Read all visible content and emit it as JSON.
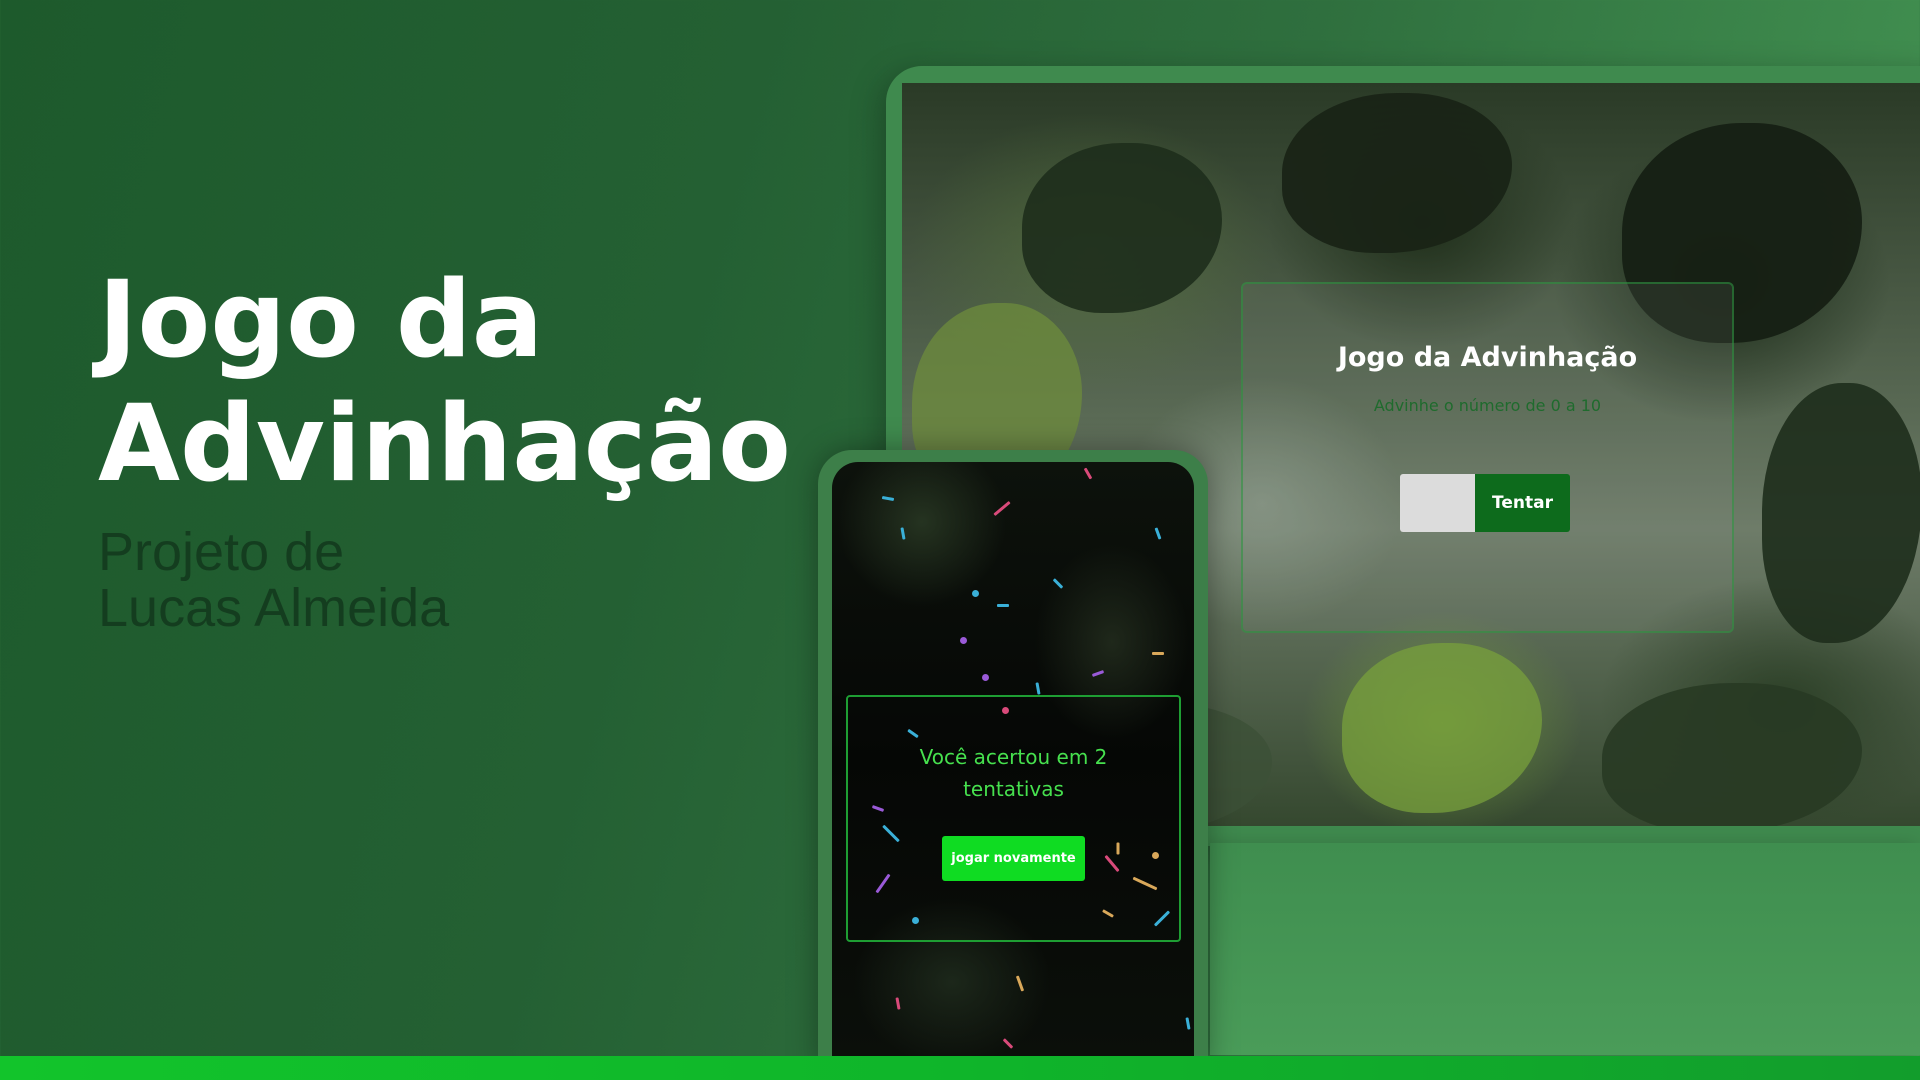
{
  "hero": {
    "title_line1": "Jogo da",
    "title_line2": "Advinhação",
    "subtitle_line1": "Projeto de",
    "subtitle_line2": "Lucas Almeida"
  },
  "desktop_game": {
    "title": "Jogo da Advinhação",
    "hint": "Advinhe o número de 0 a 10",
    "input_value": "",
    "try_button": "Tentar"
  },
  "mobile_game": {
    "win_line1": "Você acertou em 2",
    "win_line2": "tentativas",
    "play_again_button": "jogar novamente"
  },
  "colors": {
    "background": "#246033",
    "accent_green": "#0fdc22",
    "button_dark_green": "#0d6b1c",
    "stripe": "#12c42b"
  }
}
